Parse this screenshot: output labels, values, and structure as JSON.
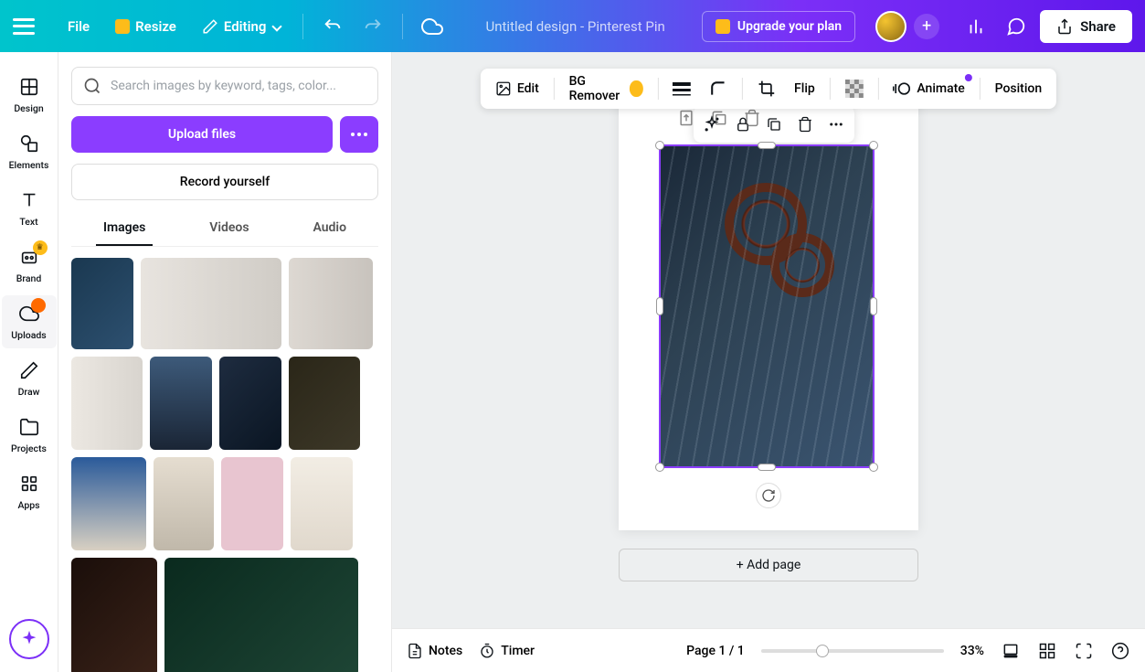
{
  "topbar": {
    "file": "File",
    "resize": "Resize",
    "editing": "Editing",
    "title": "Untitled design - Pinterest Pin",
    "upgrade": "Upgrade your plan",
    "share": "Share"
  },
  "rail": {
    "design": "Design",
    "elements": "Elements",
    "text": "Text",
    "brand": "Brand",
    "uploads": "Uploads",
    "draw": "Draw",
    "projects": "Projects",
    "apps": "Apps"
  },
  "panel": {
    "search_placeholder": "Search images by keyword, tags, color...",
    "upload": "Upload files",
    "record": "Record yourself",
    "tab_images": "Images",
    "tab_videos": "Videos",
    "tab_audio": "Audio"
  },
  "context": {
    "edit": "Edit",
    "bg_remover": "BG Remover",
    "flip": "Flip",
    "animate": "Animate",
    "position": "Position"
  },
  "canvas": {
    "add_page": "+ Add page"
  },
  "bottom": {
    "notes": "Notes",
    "timer": "Timer",
    "page_indicator": "Page 1 / 1",
    "zoom": "33%"
  }
}
